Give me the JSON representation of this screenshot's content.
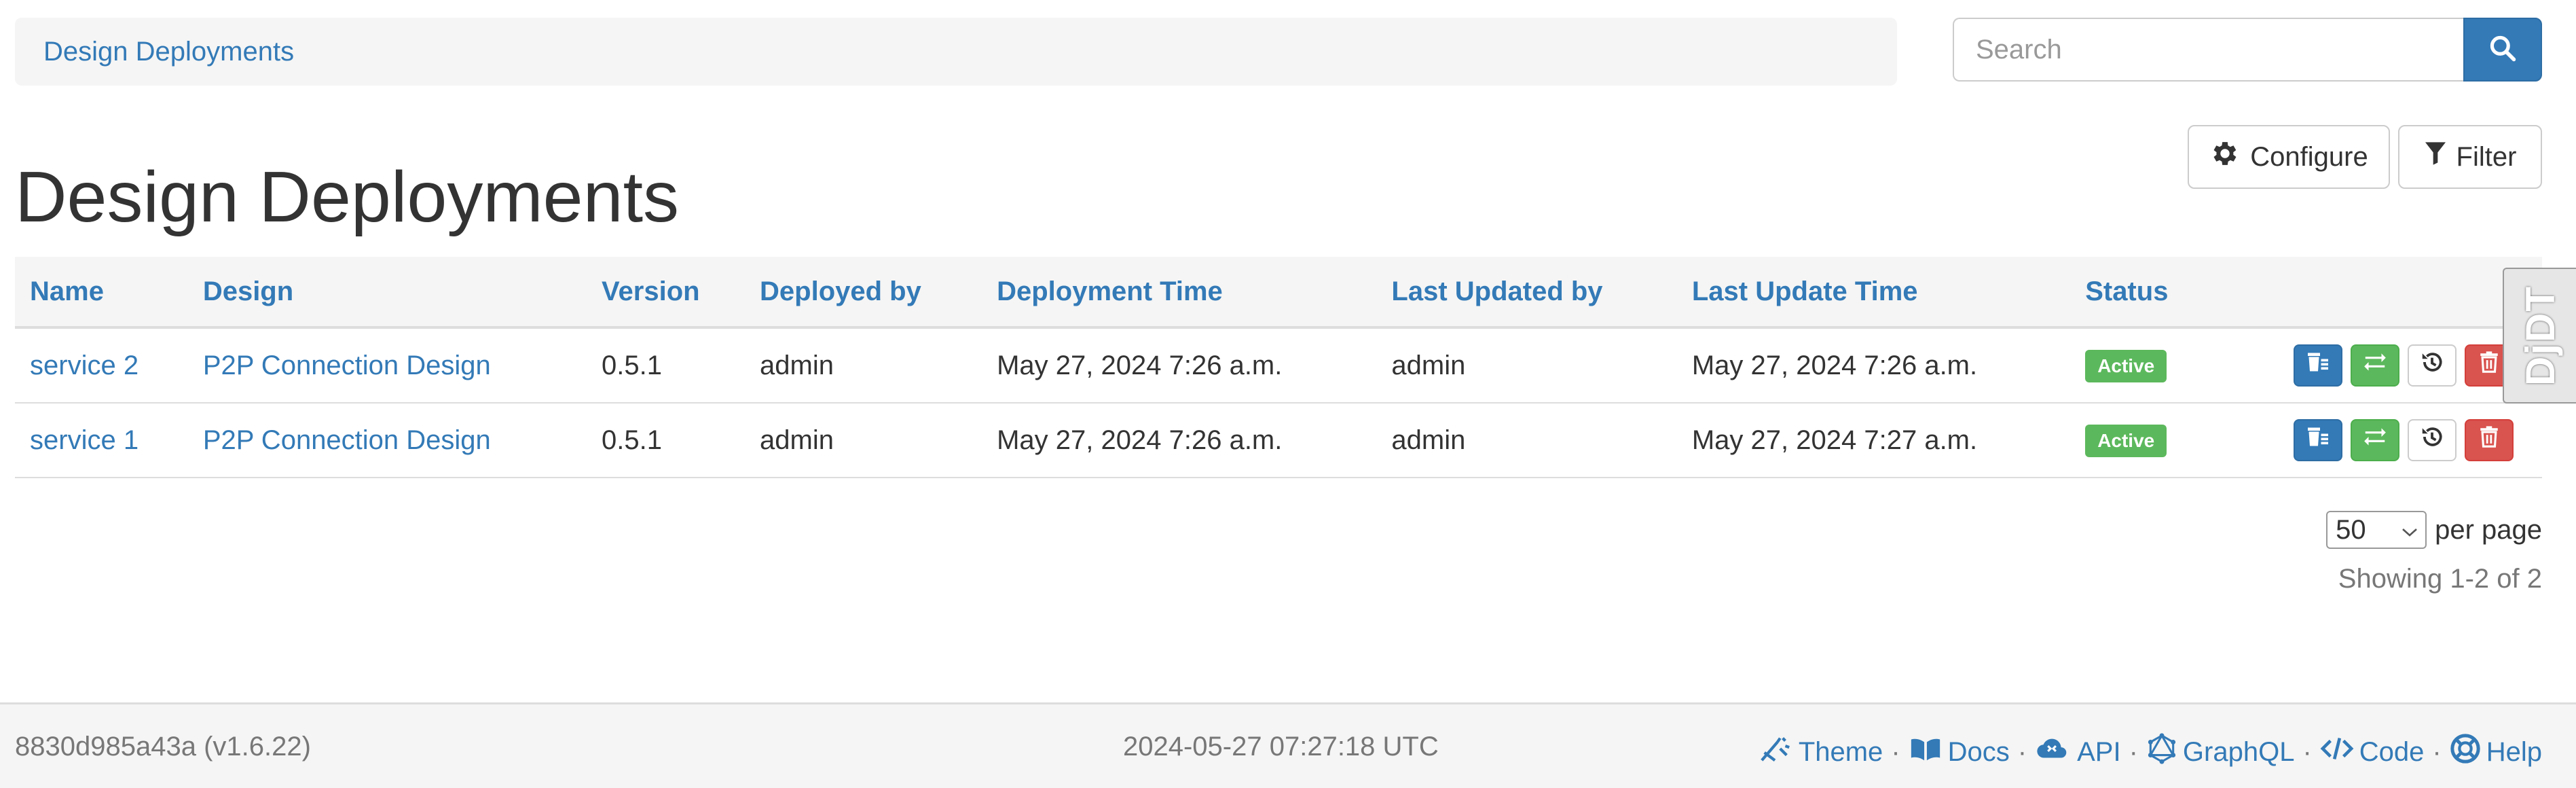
{
  "breadcrumb": {
    "label": "Design Deployments"
  },
  "search": {
    "placeholder": "Search",
    "icon": "search-icon"
  },
  "toolbar": {
    "configure_label": "Configure",
    "filter_label": "Filter"
  },
  "page": {
    "title": "Design Deployments"
  },
  "table": {
    "columns": [
      "Name",
      "Design",
      "Version",
      "Deployed by",
      "Deployment Time",
      "Last Updated by",
      "Last Update Time",
      "Status"
    ],
    "rows": [
      {
        "name": "service 2",
        "design": "P2P Connection Design",
        "version": "0.5.1",
        "deployed_by": "admin",
        "deployment_time": "May 27, 2024 7:26 a.m.",
        "last_updated_by": "admin",
        "last_update_time": "May 27, 2024 7:26 a.m.",
        "status": "Active"
      },
      {
        "name": "service 1",
        "design": "P2P Connection Design",
        "version": "0.5.1",
        "deployed_by": "admin",
        "deployment_time": "May 27, 2024 7:26 a.m.",
        "last_updated_by": "admin",
        "last_update_time": "May 27, 2024 7:27 a.m.",
        "status": "Active"
      }
    ]
  },
  "pagination": {
    "per_page_value": "50",
    "per_page_label": "per page",
    "showing": "Showing 1-2 of 2"
  },
  "footer": {
    "version": "8830d985a43a (v1.6.22)",
    "timestamp": "2024-05-27 07:27:18 UTC",
    "links": [
      "Theme",
      "Docs",
      "API",
      "GraphQL",
      "Code",
      "Help"
    ],
    "separator": "·"
  },
  "djdt": {
    "label": "DjDT"
  },
  "colors": {
    "primary": "#337ab7",
    "success": "#5cb85c",
    "danger": "#d9534f"
  }
}
